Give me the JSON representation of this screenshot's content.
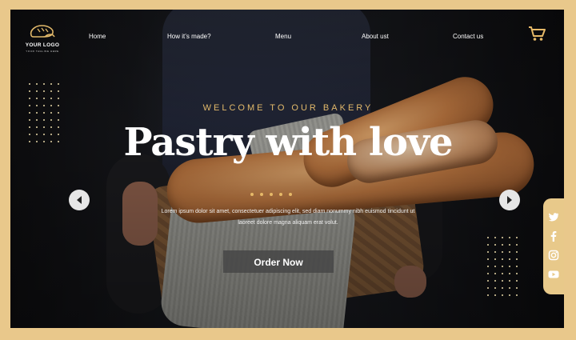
{
  "brand": {
    "logo_text": "YOUR LOGO",
    "tagline": "YOUR TAGLINE HERE",
    "logo_icon": "bread-loaf-icon"
  },
  "nav": {
    "items": [
      {
        "label": "Home"
      },
      {
        "label": "How it’s made?"
      },
      {
        "label": "Menu"
      },
      {
        "label": "About ust"
      },
      {
        "label": "Contact us"
      }
    ],
    "cart_icon": "shopping-cart-icon"
  },
  "hero": {
    "welcome": "WELCOME TO OUR BAKERY",
    "headline": "Pastry with love",
    "body": "Lorem ipsum dolor sit amet, consectetuer adipiscing elit, sed diam nonummy nibh euismod tincidunt ut laoreet dolore magna aliquam erat volut.",
    "cta_label": "Order Now",
    "slide_count": 5,
    "prev_icon": "chevron-left-icon",
    "next_icon": "chevron-right-icon"
  },
  "social": {
    "icons": [
      "twitter-icon",
      "facebook-icon",
      "instagram-icon",
      "youtube-icon"
    ]
  },
  "colors": {
    "accent": "#e6b968",
    "frame": "#e9c88b",
    "background": "#121317"
  }
}
